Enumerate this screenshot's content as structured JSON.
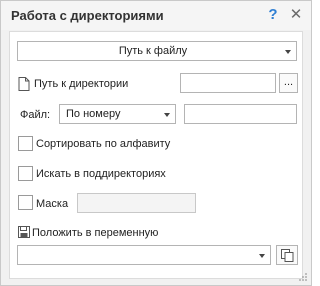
{
  "window": {
    "title": "Работа с директориями",
    "help_label": "?",
    "close_label": "✕"
  },
  "action": {
    "selected": "Путь к файлу"
  },
  "directory": {
    "label": "Путь к директории",
    "value": "",
    "browse_label": "..."
  },
  "file": {
    "label": "Файл:",
    "mode_selected": "По номеру",
    "value": ""
  },
  "options": {
    "sort_alpha_label": "Сортировать по алфавиту",
    "sort_alpha_checked": false,
    "search_subdirs_label": "Искать в поддиректориях",
    "search_subdirs_checked": false,
    "mask_label": "Маска",
    "mask_checked": false,
    "mask_value": ""
  },
  "output": {
    "label": "Положить в переменную",
    "variable_selected": ""
  },
  "icons": {
    "file": "file-icon",
    "save": "floppy-icon",
    "copy": "copy-icon",
    "help": "help-icon",
    "close": "close-icon"
  }
}
